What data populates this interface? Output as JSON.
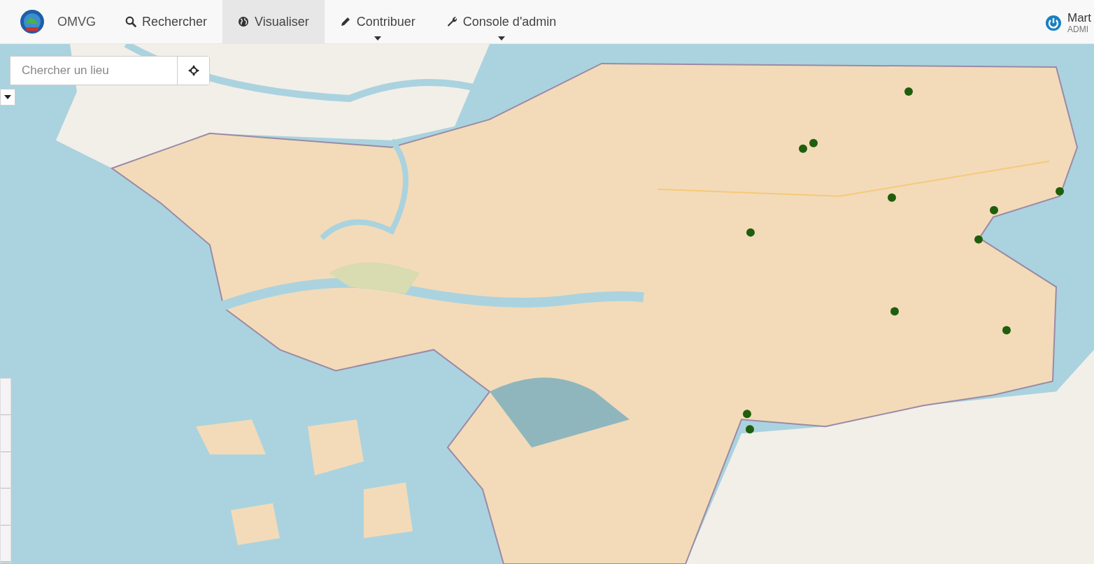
{
  "navbar": {
    "brand": "OMVG",
    "items": [
      {
        "label": "Rechercher",
        "selected": false,
        "dropdown": false
      },
      {
        "label": "Visualiser",
        "selected": true,
        "dropdown": false
      },
      {
        "label": "Contribuer",
        "selected": false,
        "dropdown": true
      },
      {
        "label": "Console d'admin",
        "selected": false,
        "dropdown": true
      }
    ],
    "user": {
      "name": "Mart",
      "role": "ADMI"
    }
  },
  "map": {
    "kind": "picture",
    "search": {
      "placeholder": "Chercher un lieu"
    }
  }
}
